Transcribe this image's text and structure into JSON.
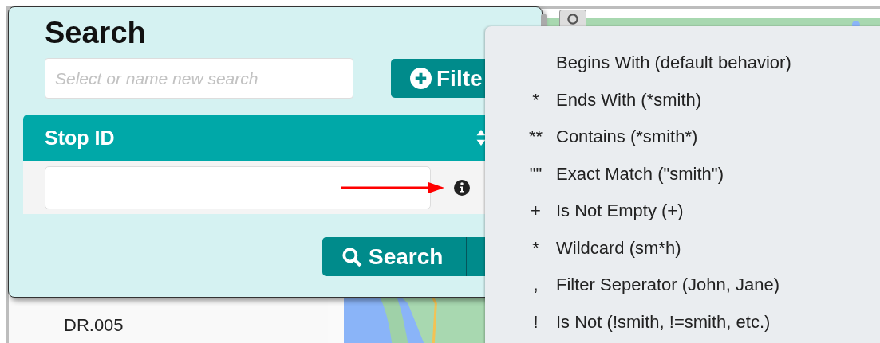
{
  "list": {
    "items": [
      "DR.005"
    ]
  },
  "search_panel": {
    "title": "Search",
    "name_field": {
      "placeholder": "Select or name new search"
    },
    "filter_button": {
      "label": "Filte"
    },
    "column": {
      "header": "Stop ID"
    },
    "search_button": {
      "label": "Search"
    }
  },
  "operator_menu": {
    "items": [
      {
        "label": "Begins With (default behavior)"
      },
      {
        "symbol": "*",
        "label": "Ends With (*smith)"
      },
      {
        "symbol": "**",
        "label": "Contains (*smith*)"
      },
      {
        "symbol": "\"\"",
        "label": "Exact Match (\"smith\")"
      },
      {
        "symbol": "+",
        "label": "Is Not Empty (+)"
      },
      {
        "symbol": "*",
        "label": "Wildcard (sm*h)"
      },
      {
        "symbol": ",",
        "label": "Filter Seperator (John, Jane)"
      },
      {
        "symbol": "!",
        "label": "Is Not (!smith, !=smith, etc.)"
      }
    ]
  }
}
